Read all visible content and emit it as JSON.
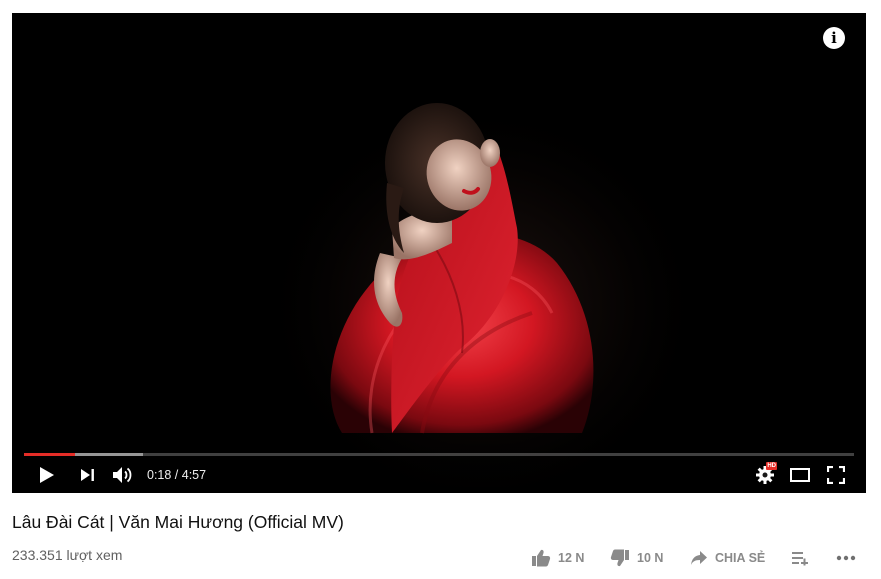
{
  "player": {
    "current_time": "0:18",
    "duration": "4:57",
    "time_display": "0:18 / 4:57",
    "progress_played_fraction": 0.062,
    "progress_loaded_fraction": 0.143,
    "hd_badge": "HD",
    "info_glyph": "i",
    "icons": {
      "info": "info-icon",
      "play": "play-icon",
      "next": "next-icon",
      "volume": "volume-icon",
      "settings": "settings-gear-icon",
      "theater": "theater-mode-icon",
      "fullscreen": "fullscreen-icon"
    },
    "colors": {
      "progress_played": "#e52d27",
      "dress": "#c4101c",
      "background": "#000000"
    }
  },
  "video": {
    "title": "Lâu Đài Cát | Văn Mai Hương (Official MV)",
    "views": "233.351 lượt xem"
  },
  "actions": {
    "like_count": "12 N",
    "dislike_count": "10 N",
    "share_label": "CHIA SẺ",
    "icons": {
      "like": "thumbs-up-icon",
      "dislike": "thumbs-down-icon",
      "share": "share-arrow-icon",
      "save": "add-to-playlist-icon",
      "more": "more-options-icon"
    }
  }
}
